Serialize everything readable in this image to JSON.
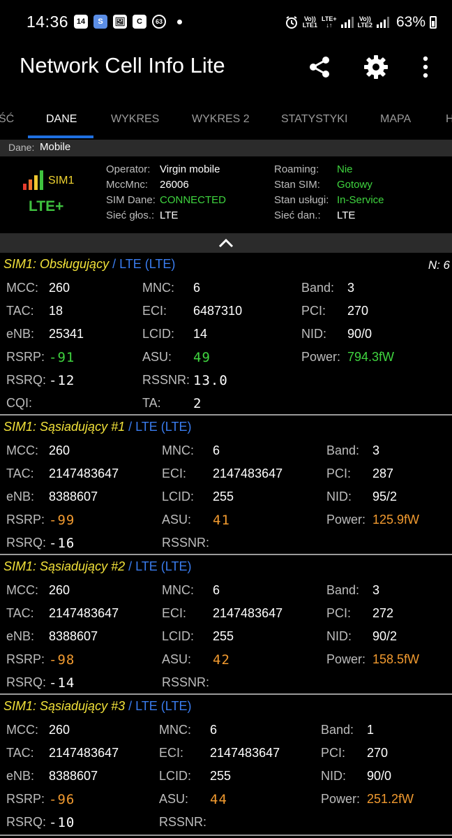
{
  "status_bar": {
    "time": "14:36",
    "notif_icons": [
      "14",
      "S",
      "🖼",
      "C",
      "63"
    ],
    "sim1_volte": "Vo))",
    "sim1_lte": "LTE+",
    "sim1_label": "LTE1",
    "sim2_volte": "Vo))",
    "sim2_label": "LTE2",
    "battery": "63%"
  },
  "app_bar": {
    "title": "Network Cell Info Lite"
  },
  "tabs": [
    "ŚĆ",
    "DANE",
    "WYKRES",
    "WYKRES 2",
    "STATYSTYKI",
    "MAPA",
    "H"
  ],
  "active_tab": "DANE",
  "dane_bar": {
    "label": "Dane:",
    "value": "Mobile"
  },
  "sim_panel": {
    "sim_label": "SIM1",
    "net_type": "LTE+",
    "left": [
      {
        "k": "Operator:",
        "v": "Virgin mobile"
      },
      {
        "k": "MccMnc:",
        "v": "26006"
      },
      {
        "k": "SIM Dane:",
        "v": "CONNECTED"
      },
      {
        "k": "Sieć głos.:",
        "v": "LTE"
      }
    ],
    "right": [
      {
        "k": "Roaming:",
        "v": "Nie"
      },
      {
        "k": "Stan SIM:",
        "v": "Gotowy"
      },
      {
        "k": "Stan usługi:",
        "v": "In-Service"
      },
      {
        "k": "Sieć dan.:",
        "v": "LTE"
      }
    ]
  },
  "serving": {
    "title": "SIM1: Obsługujący",
    "rat": " / LTE (LTE)",
    "n": "N: 6",
    "mcc": "260",
    "tac": "18",
    "enb": "25341",
    "rsrp": "-91",
    "rsrq": "-12",
    "cqi": "",
    "mnc": "6",
    "eci": "6487310",
    "lcid": "14",
    "asu": "49",
    "rssnr": "13.0",
    "ta": "2",
    "band": "3",
    "pci": "270",
    "nid": "90/0",
    "power": "794.3fW"
  },
  "neighbors": [
    {
      "title": "SIM1: Sąsiadujący #1",
      "rat": " / LTE (LTE)",
      "mcc": "260",
      "tac": "2147483647",
      "enb": "8388607",
      "rsrp": "-99",
      "rsrq": "-16",
      "mnc": "6",
      "eci": "2147483647",
      "lcid": "255",
      "asu": "41",
      "rssnr": "",
      "band": "3",
      "pci": "287",
      "nid": "95/2",
      "power": "125.9fW"
    },
    {
      "title": "SIM1: Sąsiadujący #2",
      "rat": " / LTE (LTE)",
      "mcc": "260",
      "tac": "2147483647",
      "enb": "8388607",
      "rsrp": "-98",
      "rsrq": "-14",
      "mnc": "6",
      "eci": "2147483647",
      "lcid": "255",
      "asu": "42",
      "rssnr": "",
      "band": "3",
      "pci": "272",
      "nid": "90/2",
      "power": "158.5fW"
    },
    {
      "title": "SIM1: Sąsiadujący #3",
      "rat": " / LTE (LTE)",
      "mcc": "260",
      "tac": "2147483647",
      "enb": "8388607",
      "rsrp": "-96",
      "rsrq": "-10",
      "mnc": "6",
      "eci": "2147483647",
      "lcid": "255",
      "asu": "44",
      "rssnr": "",
      "band": "1",
      "pci": "270",
      "nid": "90/0",
      "power": "251.2fW"
    }
  ],
  "labels": {
    "mcc": "MCC:",
    "tac": "TAC:",
    "enb": "eNB:",
    "rsrp": "RSRP:",
    "rsrq": "RSRQ:",
    "cqi": "CQI:",
    "mnc": "MNC:",
    "eci": "ECI:",
    "lcid": "LCID:",
    "asu": "ASU:",
    "rssnr": "RSSNR:",
    "ta": "TA:",
    "band": "Band:",
    "pci": "PCI:",
    "nid": "NID:",
    "power": "Power:"
  },
  "colors": {
    "tab_indicator": "#1f6fe0",
    "good": "#3fd43f",
    "warn": "#f19a2f",
    "section_title": "#f3e33a",
    "rat": "#3a7df0"
  },
  "icons": {
    "share": "share-icon",
    "settings": "gear-icon",
    "menu": "more-vert-icon",
    "collapse": "chevron-up-icon"
  }
}
